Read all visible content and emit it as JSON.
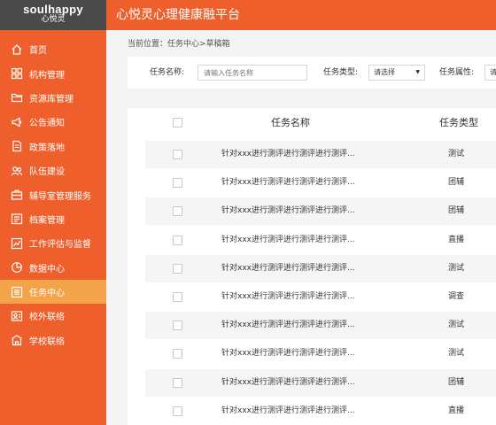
{
  "brand": {
    "logo_text": "soulhappy",
    "logo_subtext": "心悦灵",
    "app_title": "心悦灵心理健康融平台"
  },
  "sidebar": {
    "items": [
      {
        "label": "首页",
        "icon": "home-icon",
        "name": "sidebar-item-home"
      },
      {
        "label": "机构管理",
        "icon": "grid-icon",
        "name": "sidebar-item-org"
      },
      {
        "label": "资源库管理",
        "icon": "folder-icon",
        "name": "sidebar-item-resources"
      },
      {
        "label": "公告通知",
        "icon": "megaphone-icon",
        "name": "sidebar-item-notices"
      },
      {
        "label": "政策落地",
        "icon": "document-icon",
        "name": "sidebar-item-policy"
      },
      {
        "label": "队伍建设",
        "icon": "team-icon",
        "name": "sidebar-item-team"
      },
      {
        "label": "辅导室管理服务",
        "icon": "briefcase-icon",
        "name": "sidebar-item-counseling"
      },
      {
        "label": "档案管理",
        "icon": "archive-icon",
        "name": "sidebar-item-archive"
      },
      {
        "label": "工作评估与监督",
        "icon": "chart-icon",
        "name": "sidebar-item-evaluation"
      },
      {
        "label": "数据中心",
        "icon": "pie-chart-icon",
        "name": "sidebar-item-data"
      },
      {
        "label": "任务中心",
        "icon": "list-icon",
        "name": "sidebar-item-tasks",
        "active": true
      },
      {
        "label": "校外联络",
        "icon": "contact-icon",
        "name": "sidebar-item-external"
      },
      {
        "label": "学校联络",
        "icon": "school-icon",
        "name": "sidebar-item-school"
      }
    ]
  },
  "breadcrumb": "当前位置：任务中心>草稿箱",
  "filters": {
    "name_label": "任务名称:",
    "name_placeholder": "请输入任务名称",
    "type_label": "任务类型:",
    "type_value": "请选择",
    "attr_label": "任务属性:",
    "attr_value": "请"
  },
  "table": {
    "headers": {
      "name": "任务名称",
      "type": "任务类型"
    },
    "rows": [
      {
        "name": "针对xxx进行测评进行测评进行测评...",
        "type": "测试"
      },
      {
        "name": "针对xxx进行测评进行测评进行测评...",
        "type": "团辅"
      },
      {
        "name": "针对xxx进行测评进行测评进行测评...",
        "type": "团辅"
      },
      {
        "name": "针对xxx进行测评进行测评进行测评...",
        "type": "直播"
      },
      {
        "name": "针对xxx进行测评进行测评进行测评...",
        "type": "测试"
      },
      {
        "name": "针对xxx进行测评进行测评进行测评...",
        "type": "调查"
      },
      {
        "name": "针对xxx进行测评进行测评进行测评...",
        "type": "测试"
      },
      {
        "name": "针对xxx进行测评进行测评进行测评...",
        "type": "测试"
      },
      {
        "name": "针对xxx进行测评进行测评进行测评...",
        "type": "团辅"
      },
      {
        "name": "针对xxx进行测评进行测评进行测评...",
        "type": "直播"
      }
    ]
  },
  "colors": {
    "primary": "#ee5f2c",
    "active_nav": "#f3a34a",
    "logo_bg": "#4a4a4a",
    "page_bg": "#f3f3f3"
  }
}
